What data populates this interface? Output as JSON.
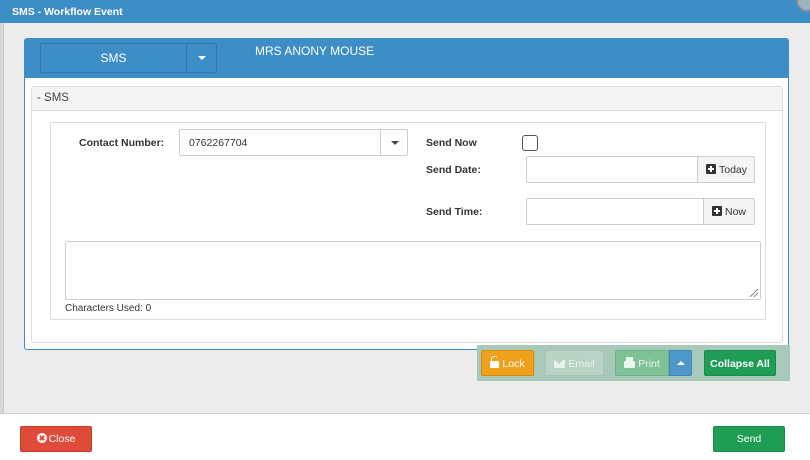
{
  "window": {
    "title": "SMS - Workflow Event"
  },
  "header": {
    "type_selector": {
      "value": "SMS"
    },
    "patient_name": "MRS ANONY MOUSE"
  },
  "section": {
    "title": "- SMS"
  },
  "form": {
    "contact_label": "Contact Number:",
    "contact_value": "0762267704",
    "send_now_label": "Send Now",
    "send_now_checked": false,
    "send_date_label": "Send Date:",
    "send_date_value": "",
    "today_label": "Today",
    "send_time_label": "Send Time:",
    "send_time_value": "",
    "now_label": "Now",
    "message_value": "",
    "chars_used": "Characters Used: 0"
  },
  "toolbar": {
    "lock_label": "Lock",
    "email_label": "Email",
    "print_label": "Print",
    "collapse_label": "Collapse All"
  },
  "footer": {
    "close_label": "Close",
    "send_label": "Send"
  }
}
